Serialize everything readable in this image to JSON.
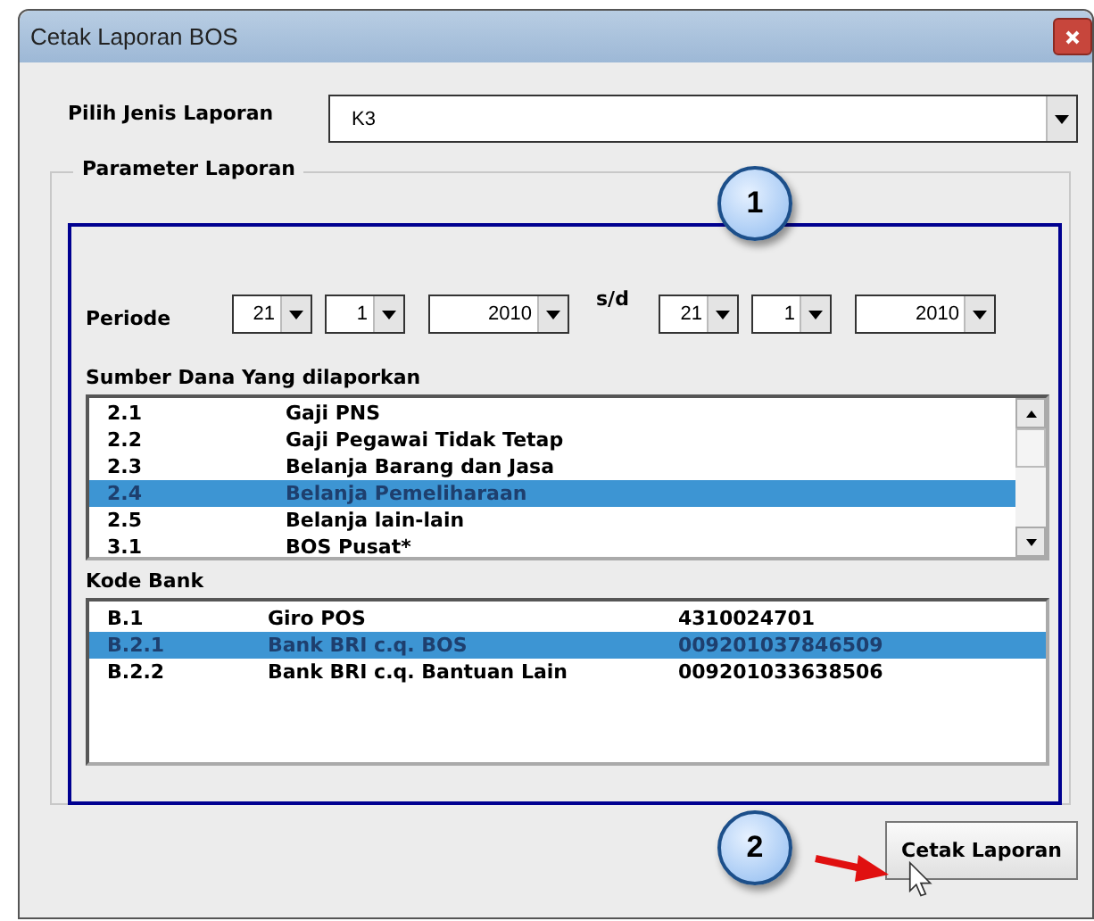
{
  "window": {
    "title": "Cetak Laporan BOS"
  },
  "report_type": {
    "label": "Pilih Jenis Laporan",
    "value": "K3"
  },
  "parameters": {
    "title": "Parameter Laporan",
    "period": {
      "label": "Periode",
      "from": [
        "21",
        "1",
        "2010"
      ],
      "separator": "s/d",
      "to": [
        "21",
        "1",
        "2010"
      ]
    },
    "funding_sources": {
      "label": "Sumber Dana Yang dilaporkan",
      "items": [
        {
          "code": "2.1",
          "name": "Gaji PNS",
          "selected": false
        },
        {
          "code": "2.2",
          "name": "Gaji Pegawai Tidak Tetap",
          "selected": false
        },
        {
          "code": "2.3",
          "name": "Belanja Barang dan Jasa",
          "selected": false
        },
        {
          "code": "2.4",
          "name": "Belanja Pemeliharaan",
          "selected": true
        },
        {
          "code": "2.5",
          "name": "Belanja lain-lain",
          "selected": false
        },
        {
          "code": "3.1",
          "name": "BOS Pusat*",
          "selected": false
        }
      ]
    },
    "banks": {
      "label": "Kode Bank",
      "items": [
        {
          "code": "B.1",
          "name": "Giro POS",
          "account": "4310024701",
          "selected": false
        },
        {
          "code": "B.2.1",
          "name": "Bank BRI c.q. BOS",
          "account": "009201037846509",
          "selected": true
        },
        {
          "code": "B.2.2",
          "name": "Bank BRI c.q. Bantuan Lain",
          "account": "009201033638506",
          "selected": false
        }
      ]
    }
  },
  "print_button": {
    "label": "Cetak Laporan"
  },
  "callouts": [
    "1",
    "2"
  ]
}
